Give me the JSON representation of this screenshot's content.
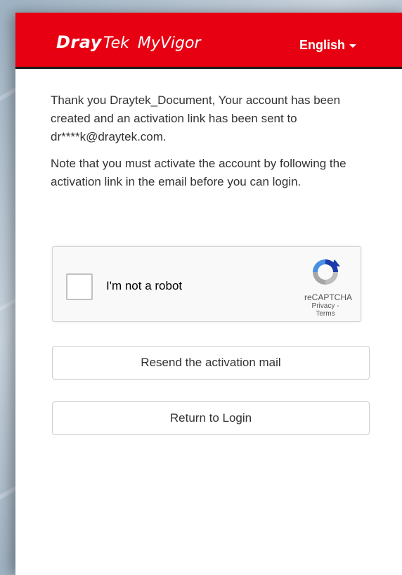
{
  "header": {
    "brand_dray": "Dray",
    "brand_tek": "Tek",
    "brand_product": "MyVigor",
    "language": "English",
    "header_color": "#e60012"
  },
  "message": {
    "paragraph1": "Thank you Draytek_Document, Your account has been created and an activation link has been sent to dr****k@draytek.com.",
    "paragraph2": "Note that you must activate the account by following the activation link in the email before you can login."
  },
  "recaptcha": {
    "label": "I'm not a robot",
    "brand": "reCAPTCHA",
    "links": "Privacy - Terms",
    "checked": false
  },
  "buttons": {
    "resend_label": "Resend the activation mail",
    "return_label": "Return to Login"
  }
}
